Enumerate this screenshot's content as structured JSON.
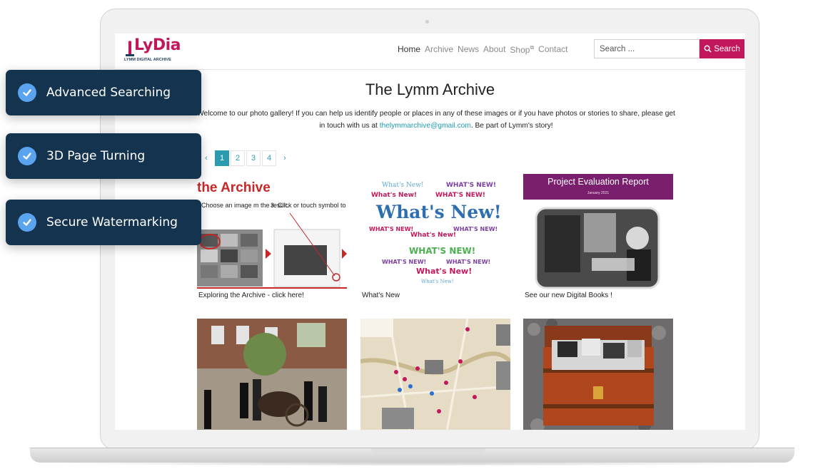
{
  "site": {
    "logo": {
      "word": "LyDia",
      "subtitle": "LYMM DIGITAL ARCHIVE"
    },
    "nav": [
      {
        "label": "Home",
        "active": true
      },
      {
        "label": "Archive",
        "active": false
      },
      {
        "label": "News",
        "active": false
      },
      {
        "label": "About",
        "active": false
      },
      {
        "label": "Shop",
        "active": false,
        "external": true
      },
      {
        "label": "Contact",
        "active": false
      }
    ],
    "search": {
      "placeholder": "Search ...",
      "button_label": "Search"
    },
    "title": "The Lymm Archive",
    "intro": {
      "before": "Welcome to our photo gallery! If you can help us identify people or places in any of these images or if you have photos or stories to share, please get in touch with us at ",
      "email": "thelymmarchive@gmail.com",
      "after": ". Be part of Lymm's story!"
    },
    "pagination": {
      "prev": "‹",
      "pages": [
        "1",
        "2",
        "3",
        "4"
      ],
      "current": "1",
      "next": "›"
    },
    "gallery": [
      {
        "caption": "Exploring the Archive - click here!",
        "thumb_text": {
          "heading": "the Archive",
          "step2": "Choose an image m the result.",
          "step3": "3. Click or touch symbol to expand."
        }
      },
      {
        "caption": "What's New",
        "thumb_text": {
          "main": "What's New!",
          "small": "WHAT'S NEW!"
        }
      },
      {
        "caption": "See our new Digital Books !",
        "thumb_text": {
          "heading": "Project Evaluation Report",
          "date": "January 2021"
        }
      },
      {
        "caption": ""
      },
      {
        "caption": ""
      },
      {
        "caption": ""
      }
    ]
  },
  "features": [
    {
      "label": "Advanced Searching",
      "icon": "check-circle-icon"
    },
    {
      "label": "3D Page Turning",
      "icon": "check-circle-icon"
    },
    {
      "label": "Secure Watermarking",
      "icon": "check-circle-icon"
    }
  ],
  "colors": {
    "brand": "#c2185b",
    "accent": "#2a9bb0",
    "badge": "#14334e",
    "check": "#5aa3ef"
  }
}
